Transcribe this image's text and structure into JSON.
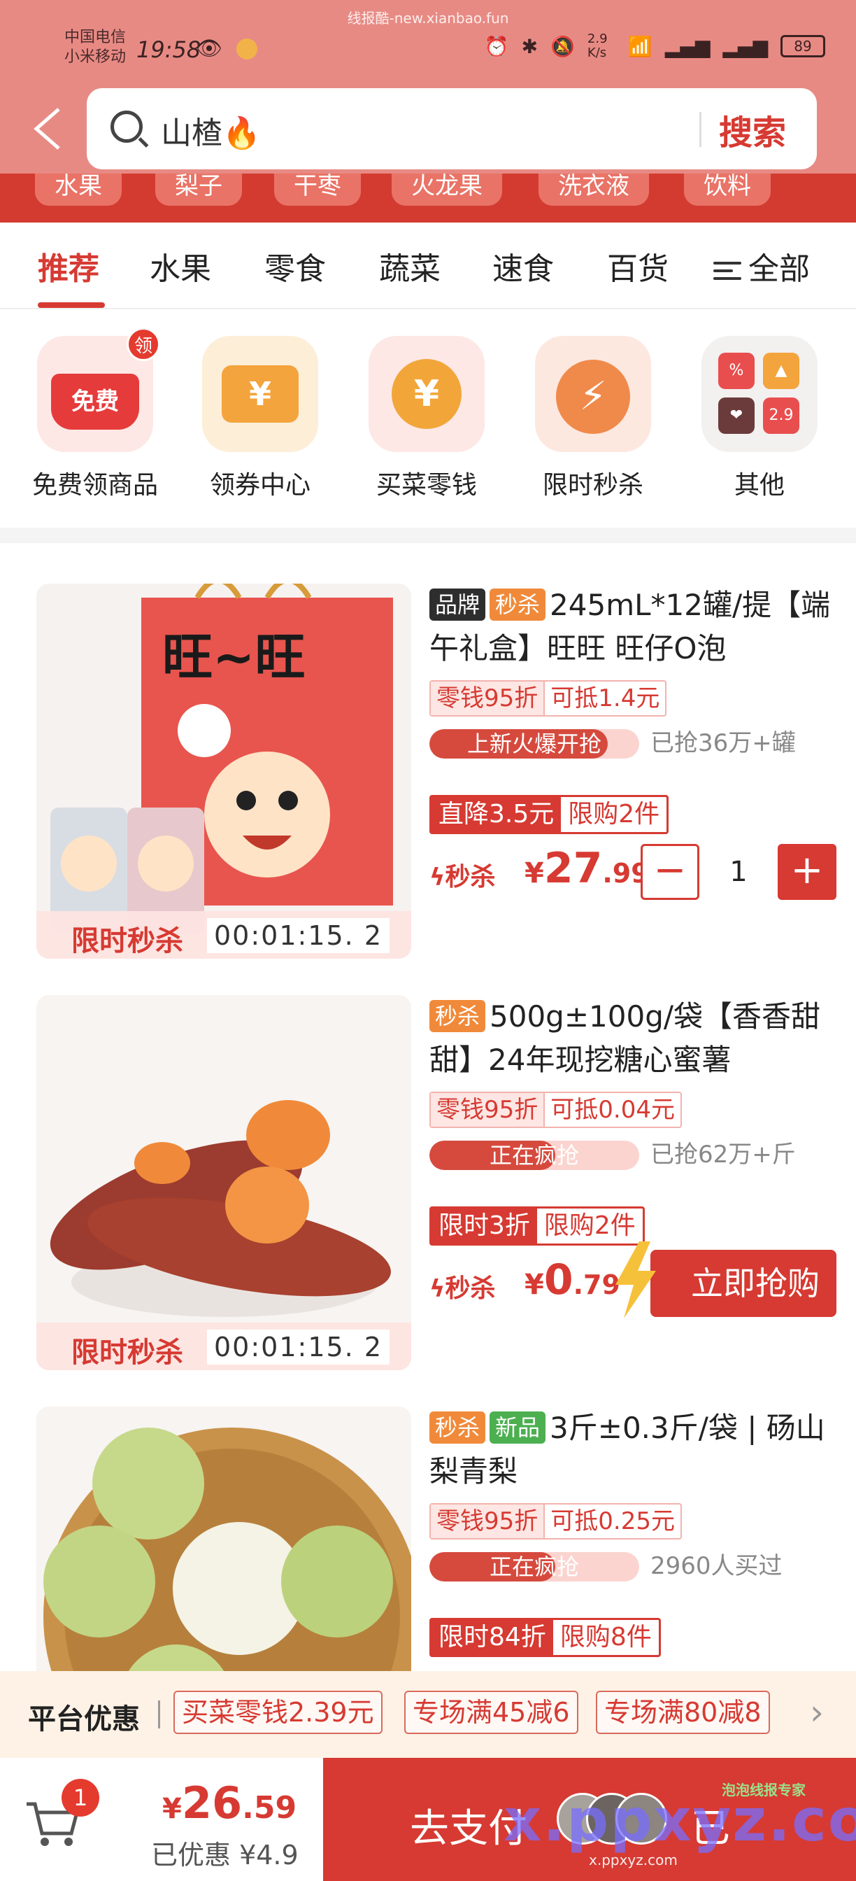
{
  "status": {
    "carrier1": "中国电信",
    "carrier2": "小米移动",
    "time": "19:58",
    "speed": "2.9 K/s",
    "battery": "89",
    "watermark": "线报酷-new.xianbao.fun"
  },
  "search": {
    "query": "山楂🔥",
    "button": "搜索"
  },
  "hot_tags": [
    "水果",
    "梨子",
    "干枣",
    "火龙果",
    "洗衣液",
    "饮料"
  ],
  "tabs": {
    "items": [
      "推荐",
      "水果",
      "零食",
      "蔬菜",
      "速食",
      "百货"
    ],
    "all": "全部"
  },
  "quick": [
    {
      "label": "免费领商品",
      "icon_text": "免费",
      "badge": "领"
    },
    {
      "label": "领券中心",
      "icon_text": "¥"
    },
    {
      "label": "买菜零钱",
      "icon_text": "¥"
    },
    {
      "label": "限时秒杀",
      "icon_text": "⚡"
    },
    {
      "label": "其他",
      "grid": [
        "%",
        "▲",
        "❤",
        "2.9"
      ]
    }
  ],
  "products": [
    {
      "tags": [
        "品牌",
        "秒杀"
      ],
      "title": "245mL*12罐/提【端午礼盒】旺旺 旺仔O泡",
      "coupon_a": "零钱95折",
      "coupon_b": "可抵1.4元",
      "progress_text": "上新火爆开抢",
      "progress": 0.85,
      "sold": "已抢36万+罐",
      "promo_a": "直降3.5元",
      "promo_b": "限购2件",
      "price_label": "秒杀",
      "currency": "¥",
      "price_int": "27",
      "price_dec": ".99",
      "qty": "1",
      "flash_label": "限时秒杀",
      "flash_timer": "00:01:15. 2"
    },
    {
      "tags": [
        "秒杀"
      ],
      "title": "500g±100g/袋【香香甜甜】24年现挖糖心蜜薯",
      "coupon_a": "零钱95折",
      "coupon_b": "可抵0.04元",
      "progress_text": "正在疯抢",
      "progress": 0.6,
      "sold": "已抢62万+斤",
      "promo_a": "限时3折",
      "promo_b": "限购2件",
      "price_label": "秒杀",
      "currency": "¥",
      "price_int": "0",
      "price_dec": ".79",
      "buy": "立即抢购",
      "flash_label": "限时秒杀",
      "flash_timer": "00:01:15. 2"
    },
    {
      "tags": [
        "秒杀",
        "新品"
      ],
      "title": "3斤±0.3斤/袋 | 砀山梨青梨",
      "coupon_a": "零钱95折",
      "coupon_b": "可抵0.25元",
      "progress_text": "正在疯抢",
      "progress": 0.6,
      "sold": "2960人买过",
      "promo_a": "限时84折",
      "promo_b": "限购8件"
    }
  ],
  "platform": {
    "title": "平台优惠",
    "chips": [
      "买菜零钱2.39元",
      "专场满45减6",
      "专场满80减8"
    ]
  },
  "checkout": {
    "cart_count": "1",
    "currency": "¥",
    "total_int": "26",
    "total_dec": ".59",
    "saved": "已优惠 ¥4.9",
    "pay_label": "去支付",
    "pay_right": "已",
    "wm": "x.ppxyz.com",
    "wm_small": "x.ppxyz.com",
    "wm_tag": "泡泡线报专家"
  },
  "colors": {
    "accent": "#d63a32",
    "header": "#e88a84"
  }
}
